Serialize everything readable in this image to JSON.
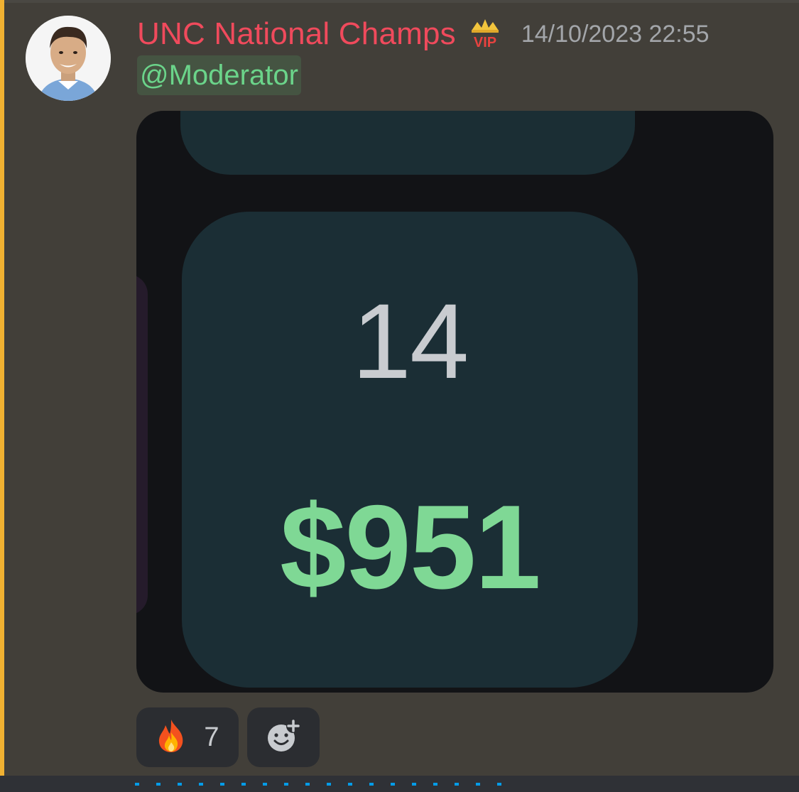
{
  "message": {
    "username": "UNC National Champs",
    "username_color": "#f04a5c",
    "badge_icon": "vip-crown-icon",
    "timestamp": "14/10/2023 22:55",
    "mention": "@Moderator",
    "mention_color": "#6bd48a",
    "accent_color": "#f0b132"
  },
  "attachment": {
    "day_number": "14",
    "amount": "$951",
    "amount_color": "#7fd895"
  },
  "reactions": [
    {
      "emoji_icon": "fire-emoji-icon",
      "count": "7"
    },
    {
      "emoji_icon": "add-reaction-icon"
    }
  ]
}
